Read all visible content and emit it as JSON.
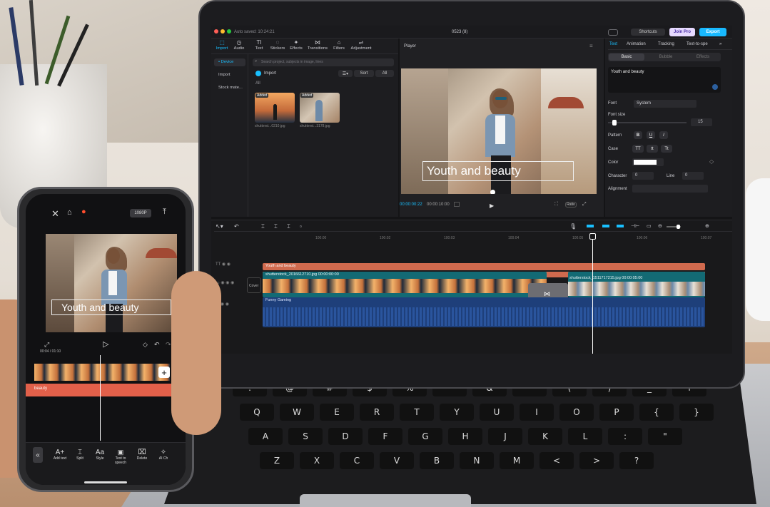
{
  "laptop": {
    "topbar": {
      "autosave": "Auto saved: 10:24:21",
      "project_title": "0523 (8)",
      "shortcuts_label": "Shortcuts",
      "join_pro_label": "Join Pro",
      "export_label": "Export"
    },
    "tool_tabs": [
      {
        "label": "Import",
        "icon": "import-icon"
      },
      {
        "label": "Audio",
        "icon": "audio-icon"
      },
      {
        "label": "Text",
        "icon": "text-icon"
      },
      {
        "label": "Stickers",
        "icon": "stickers-icon"
      },
      {
        "label": "Effects",
        "icon": "effects-icon"
      },
      {
        "label": "Transitions",
        "icon": "transitions-icon"
      },
      {
        "label": "Filters",
        "icon": "filters-icon"
      },
      {
        "label": "Adjustment",
        "icon": "adjustment-icon"
      }
    ],
    "sidebar": [
      "• Device",
      "Import",
      "Stock mate..."
    ],
    "media": {
      "search_placeholder": "Search project, subjects in image, lines",
      "import_label": "Import",
      "sort_label": "Sort",
      "all_filter_label": "All",
      "all_label": "All",
      "clips": [
        {
          "badge": "Added",
          "name": "shutterst...0210.jpg"
        },
        {
          "badge": "Added",
          "name": "shutterst...3178.jpg"
        }
      ]
    },
    "player": {
      "title": "Player",
      "overlay_text": "Youth and beauty",
      "current_time": "00:00:00:22",
      "total_time": "00:00:10:00",
      "ratio_label": "Ratio"
    },
    "props": {
      "tabs": [
        "Text",
        "Animation",
        "Tracking",
        "Text-to-spe"
      ],
      "subtabs": [
        "Basic",
        "Bubble",
        "Effects"
      ],
      "text_value": "Youth and beauty",
      "font_label": "Font",
      "font_value": "System",
      "font_size_label": "Font size",
      "font_size_value": "15",
      "pattern_label": "Pattern",
      "pattern_buttons": [
        "B",
        "U",
        "I"
      ],
      "case_label": "Case",
      "case_buttons": [
        "TT",
        "tt",
        "Tt"
      ],
      "color_label": "Color",
      "character_label": "Character",
      "character_value": "0",
      "line_label": "Line",
      "line_value": "0",
      "alignment_label": "Alignment"
    },
    "timeline": {
      "ruler": [
        "100:00",
        "100:02",
        "100:03",
        "100:04",
        "100:05",
        "100:06",
        "100:07"
      ],
      "cover_label": "Cover",
      "text_track_label": "Youth and beauty",
      "clip1_label": "shutterstock_2016612710.jpg  00:00:00:00",
      "clip2_label": "shutterstock_1511717215.jpg  00:00:05:00",
      "audio_label": "Funny Gaming"
    }
  },
  "phone": {
    "resolution_label": "1080P",
    "overlay_text": "Youth and beauty",
    "time_readout": "00:04 / 01:10",
    "track_label": "beauty",
    "bottom_tools": [
      {
        "label": "Add text",
        "icon": "add-text-icon"
      },
      {
        "label": "Split",
        "icon": "split-icon"
      },
      {
        "label": "Style",
        "icon": "style-icon"
      },
      {
        "label": "Text to speech",
        "icon": "text-to-speech-icon"
      },
      {
        "label": "Delete",
        "icon": "delete-icon"
      },
      {
        "label": "AI Ch",
        "icon": "ai-icon"
      }
    ]
  },
  "keyboard": {
    "row1": [
      "!",
      "@",
      "#",
      "$",
      "%",
      "^",
      "&",
      "*",
      "(",
      ")",
      "_",
      "+"
    ],
    "row2": [
      "Q",
      "W",
      "E",
      "R",
      "T",
      "Y",
      "U",
      "I",
      "O",
      "P",
      "{",
      "}"
    ],
    "row3": [
      "A",
      "S",
      "D",
      "F",
      "G",
      "H",
      "J",
      "K",
      "L",
      ":",
      "\""
    ],
    "row4": [
      "Z",
      "X",
      "C",
      "V",
      "B",
      "N",
      "M",
      "<",
      ">",
      "?"
    ]
  },
  "colors": {
    "accent": "#19c0ff",
    "text_track": "#d06a4e",
    "video_track": "#136a74",
    "audio_track": "#1e3f7a",
    "join_pro": "#e6d9ff",
    "export": "#18b9ff"
  }
}
